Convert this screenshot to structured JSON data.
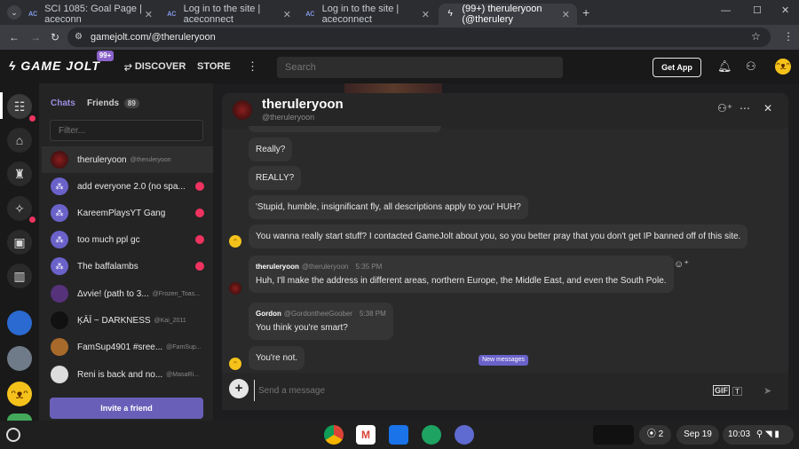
{
  "browser": {
    "tabs": [
      {
        "title": "SCI 1085: Goal Page | aceconn",
        "favicon": "ac-icon"
      },
      {
        "title": "Log in to the site | aceconnect",
        "favicon": "ac-icon"
      },
      {
        "title": "Log in to the site | aceconnect",
        "favicon": "ac-icon"
      },
      {
        "title": "(99+) theruleryoon (@therulery",
        "favicon": "gamejolt-icon"
      }
    ],
    "url": "gamejolt.com/@theruleryoon"
  },
  "header": {
    "logo": "GAME JOLT",
    "notif_count": "99+",
    "nav": {
      "discover": "DISCOVER",
      "store": "STORE"
    },
    "search_placeholder": "Search",
    "get_app": "Get App"
  },
  "sidebar": {
    "tab_chats": "Chats",
    "tab_friends": "Friends",
    "friends_count": "89",
    "filter_placeholder": "Filter...",
    "invite": "Invite a friend",
    "items": [
      {
        "name": "theruleryoon",
        "handle": "@theruleryoon",
        "unread": false
      },
      {
        "name": "add everyone 2.0 (no spa...",
        "handle": "",
        "unread": true
      },
      {
        "name": "KareemPlaysYT Gang",
        "handle": "",
        "unread": true
      },
      {
        "name": "too much ppl gc",
        "handle": "",
        "unread": true
      },
      {
        "name": "The baffalambs",
        "handle": "",
        "unread": true
      },
      {
        "name": "Δvvie! (path to 3...",
        "handle": "@Frozen_Toas...",
        "unread": false
      },
      {
        "name": "ĶĀĪ ~ DARKNESS",
        "handle": "@Kai_2011",
        "unread": false
      },
      {
        "name": "FamSup4901 #sree...",
        "handle": "@FamSup...",
        "unread": false
      },
      {
        "name": "Reni is back and no...",
        "handle": "@MasaRi...",
        "unread": false
      }
    ]
  },
  "chat": {
    "title": "theruleryoon",
    "handle": "@theruleryoon",
    "messages": [
      {
        "text": "Really?"
      },
      {
        "text": "REALLY?"
      },
      {
        "text": "'Stupid, humble, insignificant fly, all descriptions apply to you' HUH?"
      },
      {
        "text": "You wanna really start stuff? I contacted GameJolt about you, so you better pray that you don't get IP banned off of this site."
      },
      {
        "author": "theruleryoon",
        "author_handle": "@theruleryoon",
        "time": "5:35 PM",
        "text": "Huh, I'll make the address in different areas, northern Europe, the Middle East, and even the South Pole."
      },
      {
        "author": "Gordon",
        "author_handle": "@GordontheeGoober",
        "time": "5:38 PM",
        "text": "You think you're smart?"
      },
      {
        "text": "You're not."
      }
    ],
    "new_messages": "New messages",
    "composer_placeholder": "Send a message"
  },
  "shelf": {
    "notif_count": "2",
    "date": "Sep 19",
    "time": "10:03"
  }
}
